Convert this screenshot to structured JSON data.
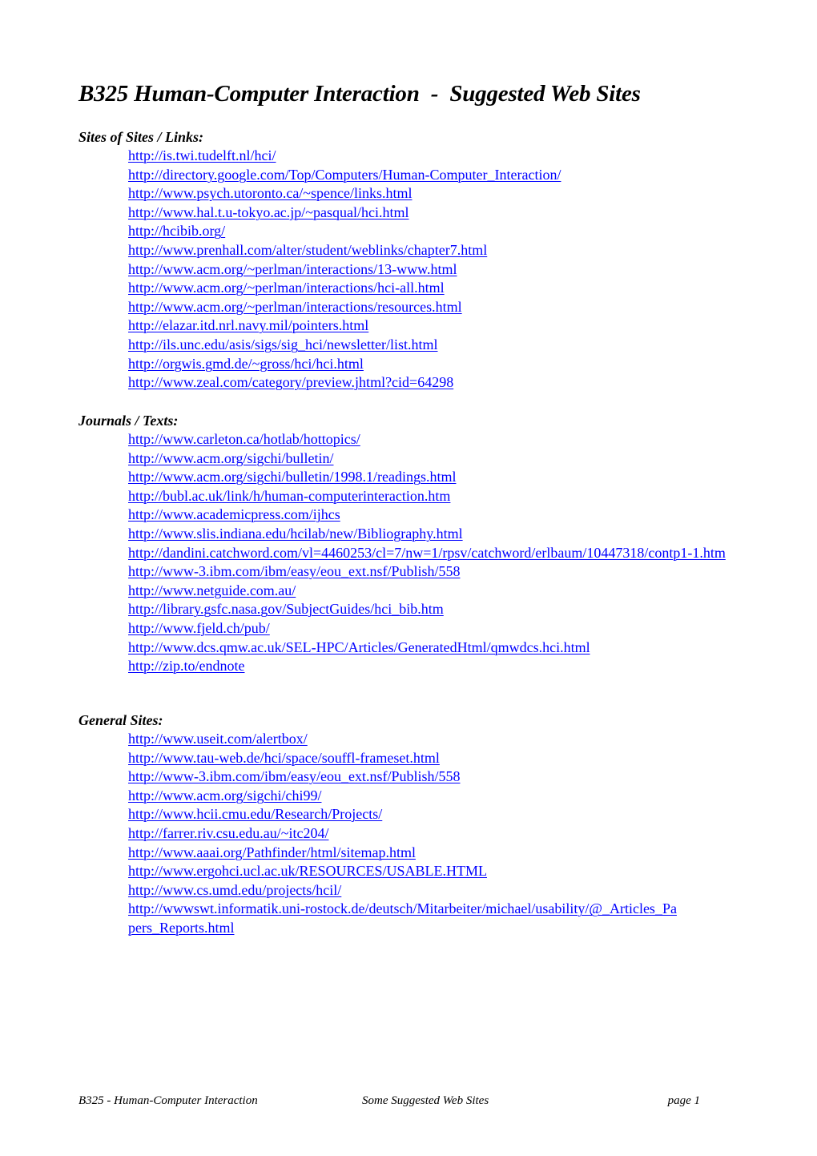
{
  "document": {
    "title": "B325 Human-Computer Interaction  -  Suggested Web Sites",
    "link_color": "#0000ff"
  },
  "sections": [
    {
      "heading": "Sites of Sites / Links:",
      "links": [
        "http://is.twi.tudelft.nl/hci/",
        "http://directory.google.com/Top/Computers/Human-Computer_Interaction/",
        "http://www.psych.utoronto.ca/~spence/links.html",
        "http://www.hal.t.u-tokyo.ac.jp/~pasqual/hci.html",
        "http://hcibib.org/",
        "http://www.prenhall.com/alter/student/weblinks/chapter7.html",
        "http://www.acm.org/~perlman/interactions/13-www.html",
        "http://www.acm.org/~perlman/interactions/hci-all.html",
        "http://www.acm.org/~perlman/interactions/resources.html",
        "http://elazar.itd.nrl.navy.mil/pointers.html",
        "http://ils.unc.edu/asis/sigs/sig_hci/newsletter/list.html",
        "http://orgwis.gmd.de/~gross/hci/hci.html",
        "http://www.zeal.com/category/preview.jhtml?cid=64298"
      ]
    },
    {
      "heading": "Journals / Texts:",
      "links": [
        "http://www.carleton.ca/hotlab/hottopics/",
        "http://www.acm.org/sigchi/bulletin/",
        "http://www.acm.org/sigchi/bulletin/1998.1/readings.html",
        "http://bubl.ac.uk/link/h/human-computerinteraction.htm",
        "http://www.academicpress.com/ijhcs",
        "http://www.slis.indiana.edu/hcilab/new/Bibliography.html",
        "http://dandini.catchword.com/vl=4460253/cl=7/nw=1/rpsv/catchword/erlbaum/10447318/contp1-1.htm",
        "http://www-3.ibm.com/ibm/easy/eou_ext.nsf/Publish/558",
        "http://www.netguide.com.au/",
        "http://library.gsfc.nasa.gov/SubjectGuides/hci_bib.htm",
        "http://www.fjeld.ch/pub/",
        "http://www.dcs.qmw.ac.uk/SEL-HPC/Articles/GeneratedHtml/qmwdcs.hci.html",
        "http://zip.to/endnote"
      ]
    },
    {
      "heading": "General Sites:",
      "links": [
        "http://www.useit.com/alertbox/",
        "http://www.tau-web.de/hci/space/souffl-frameset.html",
        "http://www-3.ibm.com/ibm/easy/eou_ext.nsf/Publish/558",
        "http://www.acm.org/sigchi/chi99/",
        "http://www.hcii.cmu.edu/Research/Projects/",
        "http://farrer.riv.csu.edu.au/~itc204/",
        "http://www.aaai.org/Pathfinder/html/sitemap.html",
        "http://www.ergohci.ucl.ac.uk/RESOURCES/USABLE.HTML",
        "http://www.cs.umd.edu/projects/hcil/",
        "http://wwwswt.informatik.uni-rostock.de/deutsch/Mitarbeiter/michael/usability/@_Articles_Papers_Reports.html"
      ]
    }
  ],
  "footer": {
    "left": "B325 - Human-Computer Interaction",
    "center": "Some Suggested Web Sites",
    "right": "page 1"
  }
}
